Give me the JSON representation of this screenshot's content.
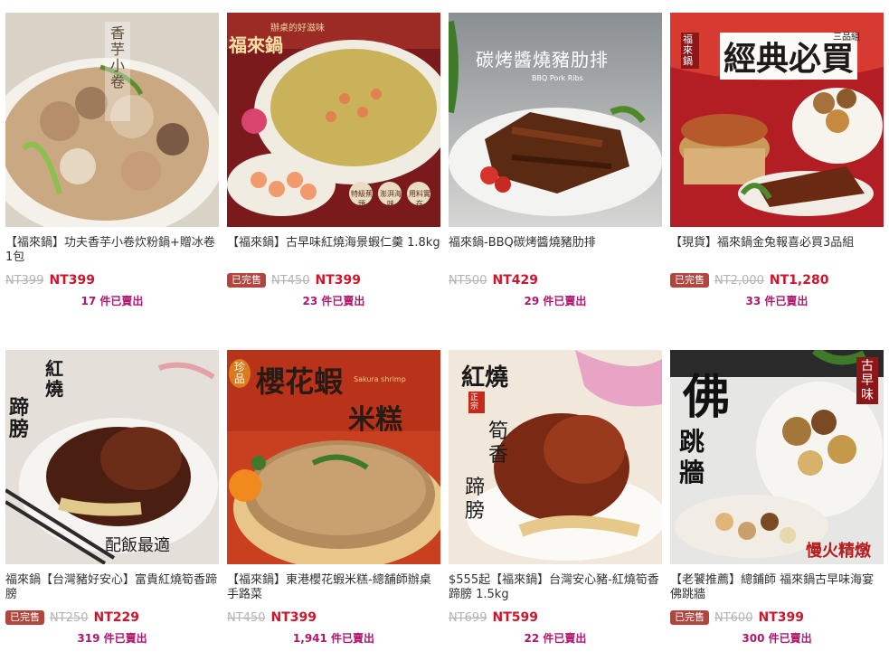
{
  "products": [
    {
      "title": "【福來鍋】功夫香芋小卷炊粉鍋+贈冰卷1包",
      "badge": "",
      "original_price": "NT399",
      "price": "NT399",
      "sold": "17 件已賣出",
      "image_text": [
        "香芋小卷"
      ]
    },
    {
      "title": "【福來鍋】古早味紅燒海景蝦仁羹 1.8kg",
      "badge": "已完售",
      "original_price": "NT450",
      "price": "NT399",
      "sold": "23 件已賣出",
      "image_text": [
        "福來鍋",
        "辦桌的好滋味",
        "特級蕉頭",
        "澎湃海味",
        "用料實在"
      ]
    },
    {
      "title": "福來鍋-BBQ碳烤醬燒豬肋排",
      "badge": "",
      "original_price": "NT500",
      "price": "NT429",
      "sold": "29 件已賣出",
      "image_text": [
        "碳烤醬燒豬肋排",
        "BBQ Pork Ribs"
      ]
    },
    {
      "title": "【現貨】福來鍋金兔報喜必買3品組",
      "badge": "已完售",
      "original_price": "NT2,000",
      "price": "NT1,280",
      "sold": "33 件已賣出",
      "image_text": [
        "福來鍋",
        "經典必買",
        "三品組"
      ]
    },
    {
      "title": "福來鍋【台灣豬好安心】富貴紅燒筍香蹄膀",
      "badge": "已完售",
      "original_price": "NT250",
      "price": "NT229",
      "sold": "319 件已賣出",
      "image_text": [
        "紅燒",
        "蹄膀",
        "配飯最適"
      ]
    },
    {
      "title": "【福來鍋】東港櫻花蝦米糕-總舖師辦桌手路菜",
      "badge": "",
      "original_price": "NT450",
      "price": "NT399",
      "sold": "1,941 件已賣出",
      "image_text": [
        "珍品",
        "櫻花蝦",
        "米糕",
        "Sakura shrimp"
      ]
    },
    {
      "title": "$555起【福來鍋】台灣安心豬-紅燒筍香蹄膀 1.5kg",
      "badge": "",
      "original_price": "NT699",
      "price": "NT599",
      "sold": "22 件已賣出",
      "image_text": [
        "紅燒",
        "正宗",
        "筍香",
        "蹄膀"
      ]
    },
    {
      "title": "【老饕推薦】總鋪師 福來鍋古早味海宴佛跳牆",
      "badge": "已完售",
      "original_price": "NT600",
      "price": "NT399",
      "sold": "300 件已賣出",
      "image_text": [
        "佛",
        "跳",
        "牆",
        "古早味",
        "慢火精燉"
      ]
    }
  ],
  "colors": {
    "price": "#d0142c",
    "badge": "#b3453f",
    "sold": "#b0176e",
    "strike": "#b4b4b4"
  }
}
